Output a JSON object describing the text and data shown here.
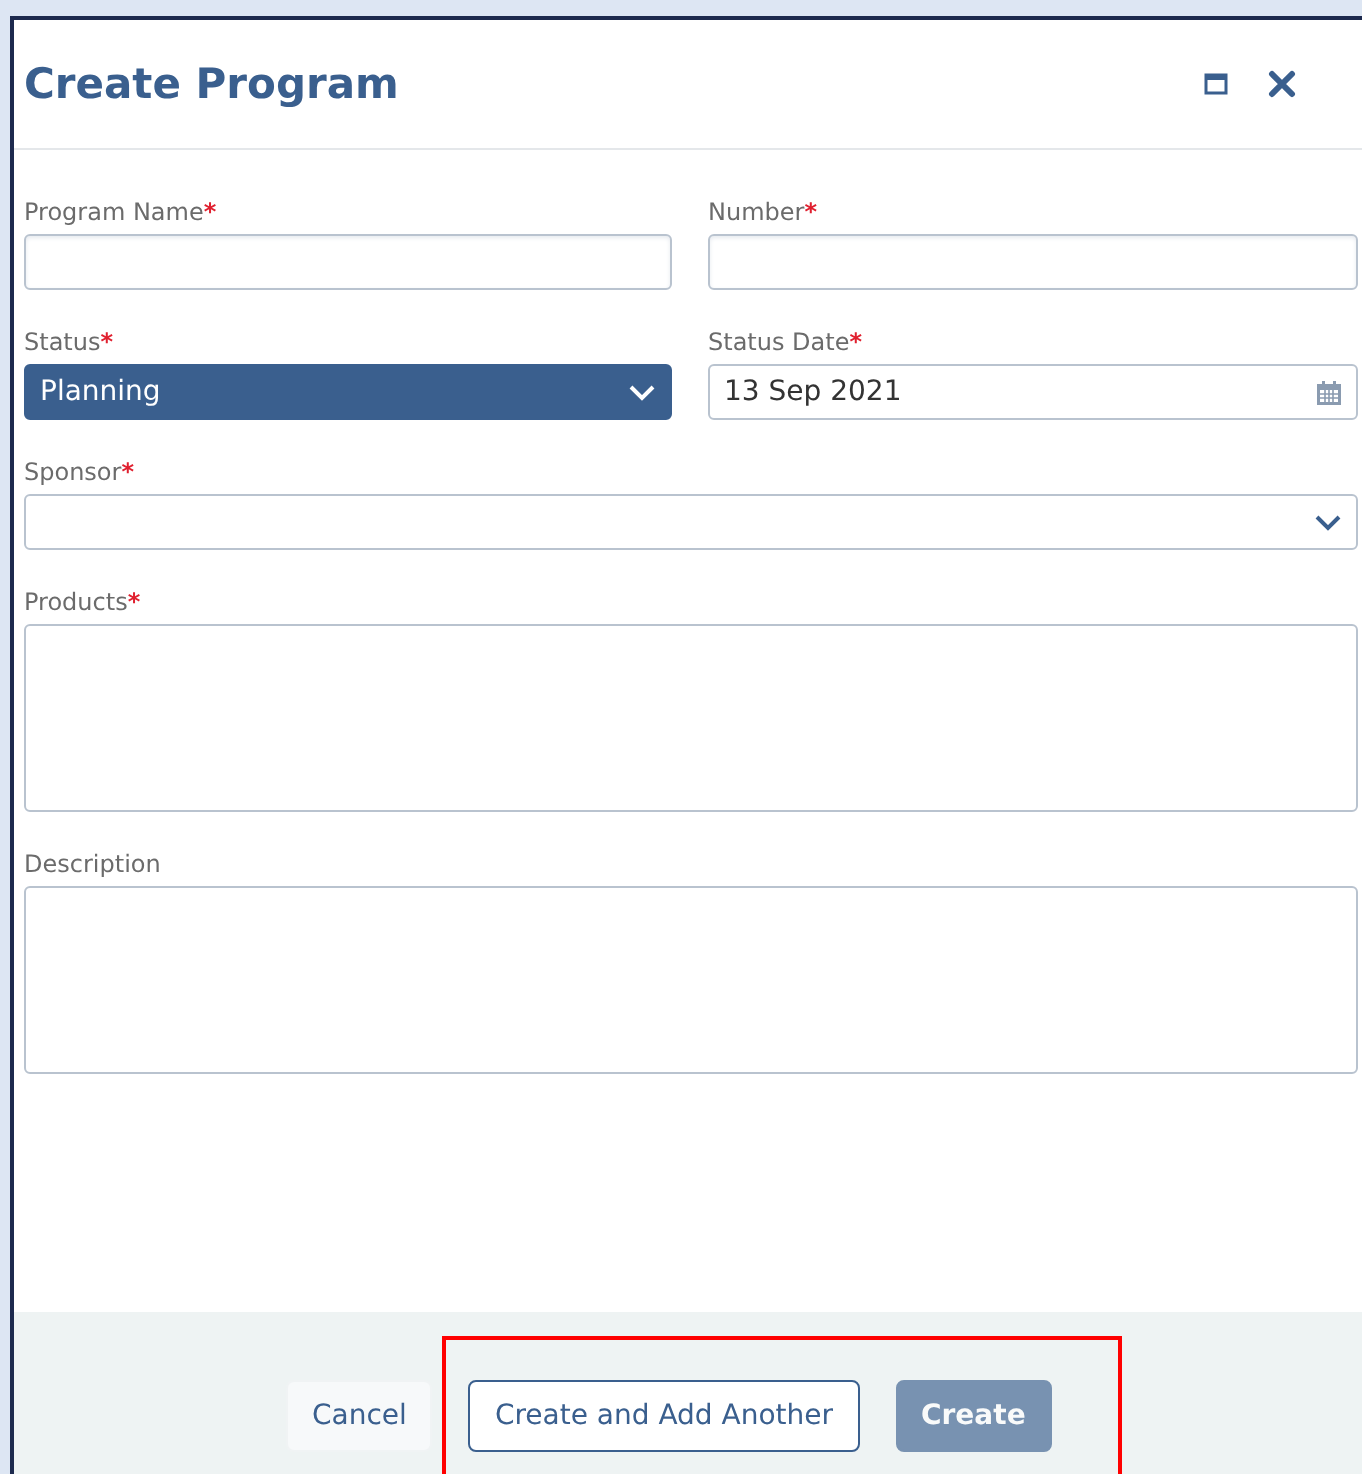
{
  "dialog": {
    "title": "Create Program"
  },
  "rows": [
    [
      {
        "kind": "text",
        "label": "Program Name",
        "marker": "*"
      },
      {
        "kind": "text",
        "label": "Number",
        "marker": "*"
      }
    ],
    [
      {
        "kind": "select",
        "label": "Status",
        "marker": "*",
        "value": "Planning",
        "highlighted": true
      },
      {
        "kind": "date",
        "label": "Status Date",
        "marker": "*",
        "value": "13 Sep 2021"
      }
    ],
    [
      {
        "kind": "select",
        "label": "Sponsor",
        "marker": "*",
        "highlighted": false
      }
    ],
    [
      {
        "kind": "textarea",
        "label": "Products",
        "marker": "*"
      }
    ],
    [
      {
        "kind": "textarea",
        "label": "Description"
      }
    ]
  ],
  "buttons": [
    {
      "kind": "text",
      "label": "Cancel",
      "disabled": false
    },
    {
      "kind": "outline",
      "label": "Create and Add Another",
      "disabled": false
    },
    {
      "kind": "primary",
      "label": "Create",
      "disabled": true
    }
  ],
  "highlight_box": true
}
